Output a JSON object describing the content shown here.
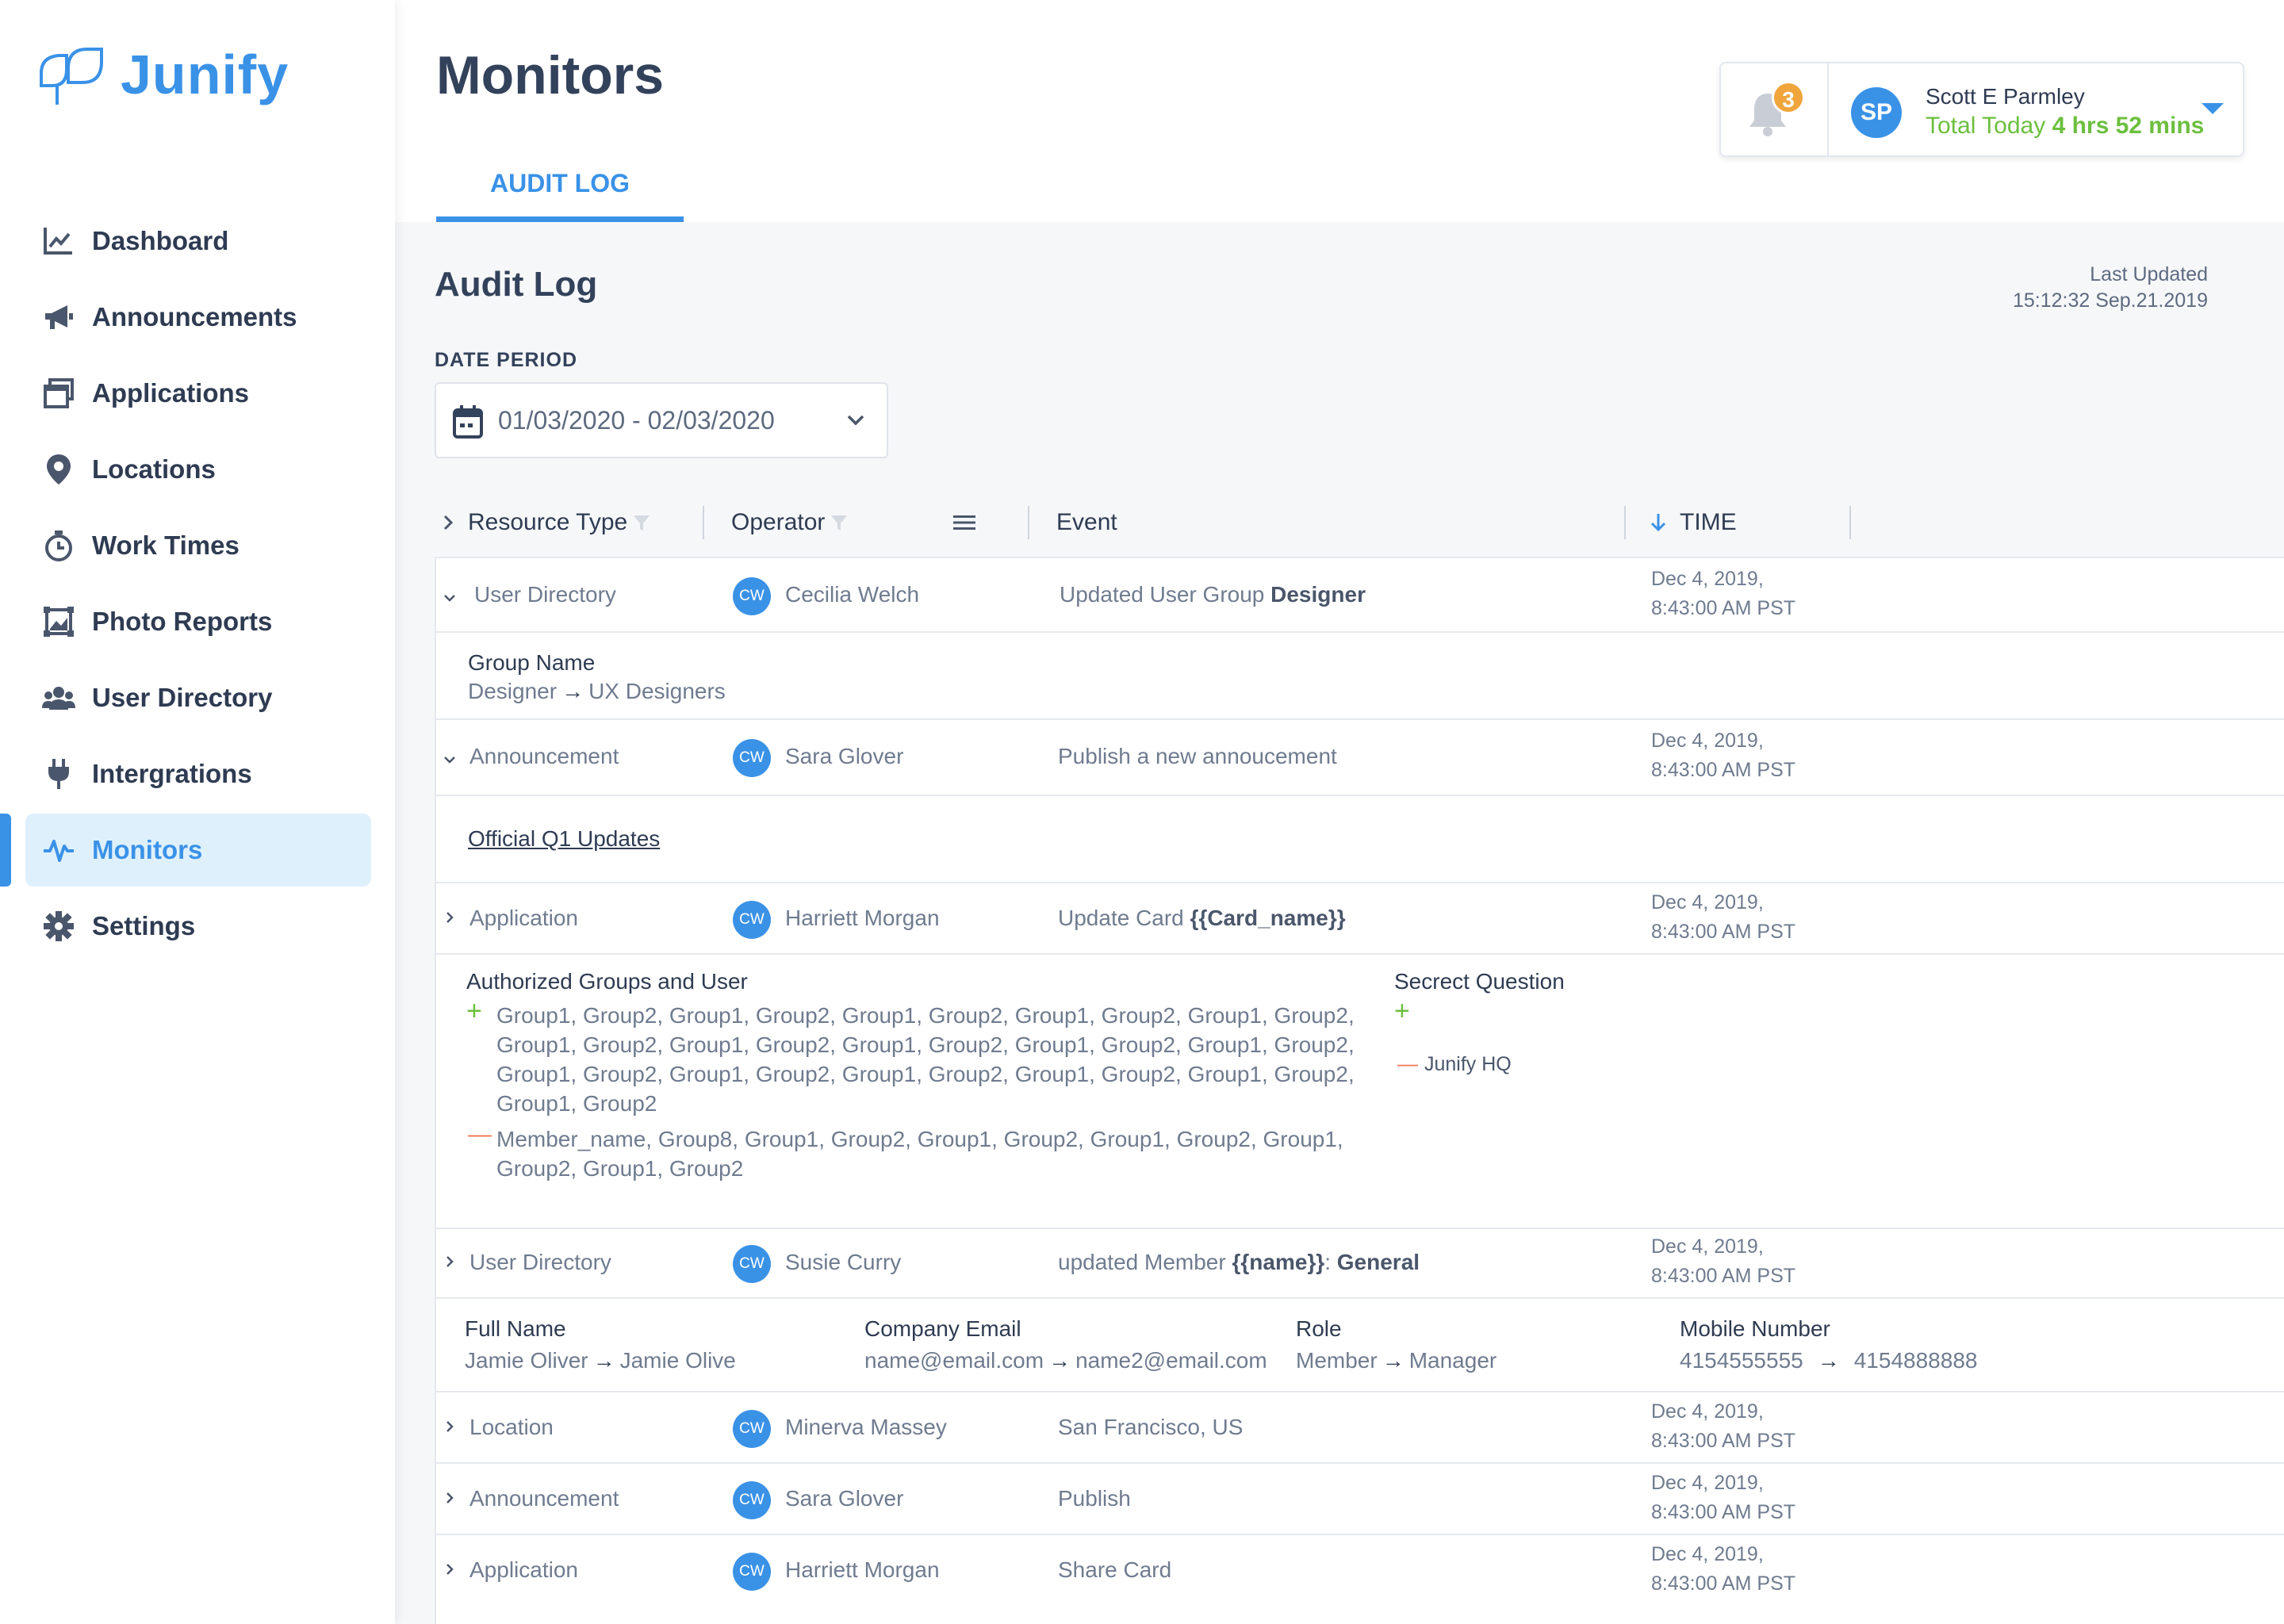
{
  "app": {
    "name": "Junify"
  },
  "sidebar": {
    "items": [
      {
        "label": "Dashboard",
        "icon": "chart-line-icon"
      },
      {
        "label": "Announcements",
        "icon": "megaphone-icon"
      },
      {
        "label": "Applications",
        "icon": "windows-icon"
      },
      {
        "label": "Locations",
        "icon": "map-pin-icon"
      },
      {
        "label": "Work Times",
        "icon": "stopwatch-icon"
      },
      {
        "label": "Photo Reports",
        "icon": "photo-frame-icon"
      },
      {
        "label": "User Directory",
        "icon": "users-icon"
      },
      {
        "label": "Intergrations",
        "icon": "plug-icon"
      },
      {
        "label": "Monitors",
        "icon": "pulse-icon",
        "active": true
      },
      {
        "label": "Settings",
        "icon": "gear-icon"
      }
    ]
  },
  "header": {
    "title": "Monitors",
    "tab": "AUDIT LOG",
    "notifications": "3",
    "user": {
      "initials": "SP",
      "name": "Scott E Parmley",
      "total_label": "Total Today",
      "total_value": "4 hrs 52 mins"
    }
  },
  "audit": {
    "title": "Audit Log",
    "last_updated_label": "Last Updated",
    "last_updated_value": "15:12:32 Sep.21.2019",
    "date_period_label": "DATE PERIOD",
    "date_period_value": "01/03/2020 - 02/03/2020",
    "columns": {
      "resource": "Resource Type",
      "operator": "Operator",
      "event": "Event",
      "time": "TIME"
    }
  },
  "rows": [
    {
      "resource": "User Directory",
      "operator_initials": "CW",
      "operator": "Cecilia Welch",
      "event": "Updated User Group ",
      "event_bold": "Designer",
      "time_date": "Dec 4, 2019,",
      "time_clock": "8:43:00 AM PST"
    },
    {
      "resource": "Announcement",
      "operator_initials": "CW",
      "operator": "Sara Glover",
      "event": "Publish a new annoucement",
      "event_bold": "",
      "time_date": "Dec 4, 2019,",
      "time_clock": "8:43:00 AM PST"
    },
    {
      "resource": "Application",
      "operator_initials": "CW",
      "operator": "Harriett Morgan",
      "event": "Update Card ",
      "event_bold": "{{Card_name}}",
      "time_date": "Dec 4, 2019,",
      "time_clock": "8:43:00 AM PST"
    },
    {
      "resource": "User Directory",
      "operator_initials": "CW",
      "operator": "Susie Curry",
      "event": "updated Member ",
      "event_bold": "{{name}}",
      "event_suffix": ": ",
      "event_bold2": "General",
      "time_date": "Dec 4, 2019,",
      "time_clock": "8:43:00 AM PST"
    },
    {
      "resource": "Location",
      "operator_initials": "CW",
      "operator": "Minerva Massey",
      "event": "San Francisco, US",
      "event_bold": "",
      "time_date": "Dec 4, 2019,",
      "time_clock": "8:43:00 AM PST"
    },
    {
      "resource": "Announcement",
      "operator_initials": "CW",
      "operator": "Sara Glover",
      "event": "Publish",
      "event_bold": "",
      "time_date": "Dec 4, 2019,",
      "time_clock": "8:43:00 AM PST"
    },
    {
      "resource": "Application",
      "operator_initials": "CW",
      "operator": "Harriett Morgan",
      "event": "Share Card",
      "event_bold": "",
      "time_date": "Dec 4, 2019,",
      "time_clock": "8:43:00 AM PST"
    }
  ],
  "details": {
    "group": {
      "label": "Group Name",
      "from": "Designer",
      "to": "UX Designers"
    },
    "announcement_link": "Official Q1 Updates",
    "application": {
      "groups_label": "Authorized Groups and User",
      "added": [
        "Group1, Group2, Group1, Group2, Group1, Group2, Group1, Group2, Group1, Group2,",
        "Group1, Group2, Group1, Group2, Group1, Group2, Group1, Group2, Group1, Group2,",
        "Group1, Group2, Group1, Group2, Group1, Group2, Group1, Group2, Group1, Group2,",
        "Group1, Group2"
      ],
      "removed": [
        "Member_name, Group8, Group1, Group2, Group1, Group2, Group1, Group2, Group1,",
        "Group2, Group1, Group2"
      ],
      "secret_label": "Secrect Question",
      "secret_removed": "Junify HQ"
    },
    "member": {
      "full_name_label": "Full Name",
      "full_name_from": "Jamie Oliver",
      "full_name_to": "Jamie Olive",
      "email_label": "Company Email",
      "email_from": "name@email.com",
      "email_to": "name2@email.com",
      "role_label": "Role",
      "role_from": "Member",
      "role_to": "Manager",
      "mobile_label": "Mobile Number",
      "mobile_from": "4154555555",
      "mobile_to": "4154888888"
    }
  },
  "colors": {
    "accent": "#3a92e7",
    "green": "#6cbf3e",
    "orange": "#f0a63c",
    "red": "#ef7b57"
  }
}
